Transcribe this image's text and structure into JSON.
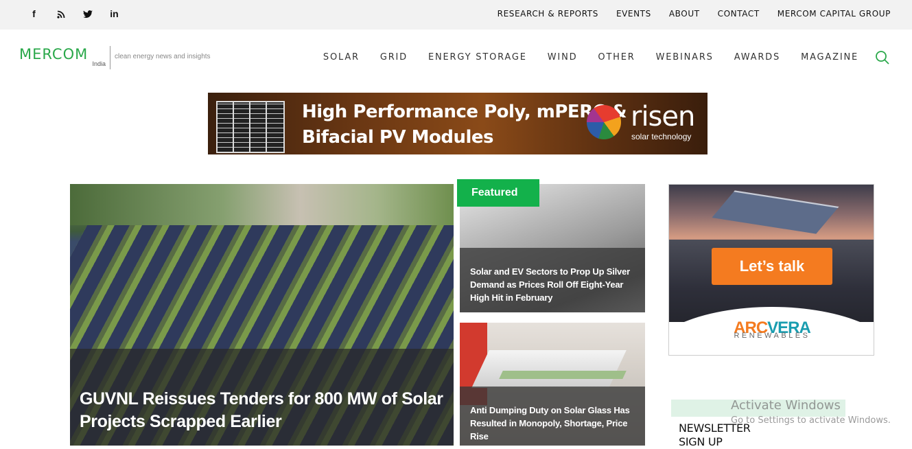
{
  "topbar": {
    "social": [
      {
        "name": "facebook",
        "glyph": "f"
      },
      {
        "name": "rss",
        "glyph": ""
      },
      {
        "name": "twitter",
        "glyph": ""
      },
      {
        "name": "linkedin",
        "glyph": "in"
      }
    ],
    "links": [
      "RESEARCH & REPORTS",
      "EVENTS",
      "ABOUT",
      "CONTACT",
      "MERCOM CAPITAL GROUP"
    ]
  },
  "logo": {
    "name": "MERCOM",
    "sub": "India",
    "tagline": "clean energy news and insights"
  },
  "nav": {
    "items": [
      "SOLAR",
      "GRID",
      "ENERGY STORAGE",
      "WIND",
      "OTHER",
      "WEBINARS",
      "AWARDS",
      "MAGAZINE"
    ],
    "search_icon": "search-icon"
  },
  "banner": {
    "line1": "High Performance Poly, mPERC &",
    "line2": "Bifacial PV Modules",
    "brand": "risen",
    "brand_sub": "solar technology"
  },
  "hero": {
    "title": "GUVNL Reissues Tenders for 800 MW of Solar Projects Scrapped Earlier"
  },
  "featured_label": "Featured",
  "cards": [
    {
      "title": "Solar and EV Sectors to Prop Up Silver Demand as Prices Roll Off Eight-Year High Hit in February"
    },
    {
      "title": "Anti Dumping Duty on Solar Glass Has Resulted in Monopoly, Shortage, Price Rise"
    }
  ],
  "ad": {
    "button": "Let’s talk",
    "logo_arc": "ARC",
    "logo_vera": "VERA",
    "logo_sub": "RENEWABLES"
  },
  "newsletter": {
    "line1": "NEWSLETTER",
    "line2": "SIGN UP"
  },
  "watermark": {
    "line1": "Activate Windows",
    "line2": "Go to Settings to activate Windows."
  },
  "colors": {
    "brand_green": "#2aa84a",
    "featured_green": "#13b14b",
    "ad_orange": "#f47b20"
  }
}
